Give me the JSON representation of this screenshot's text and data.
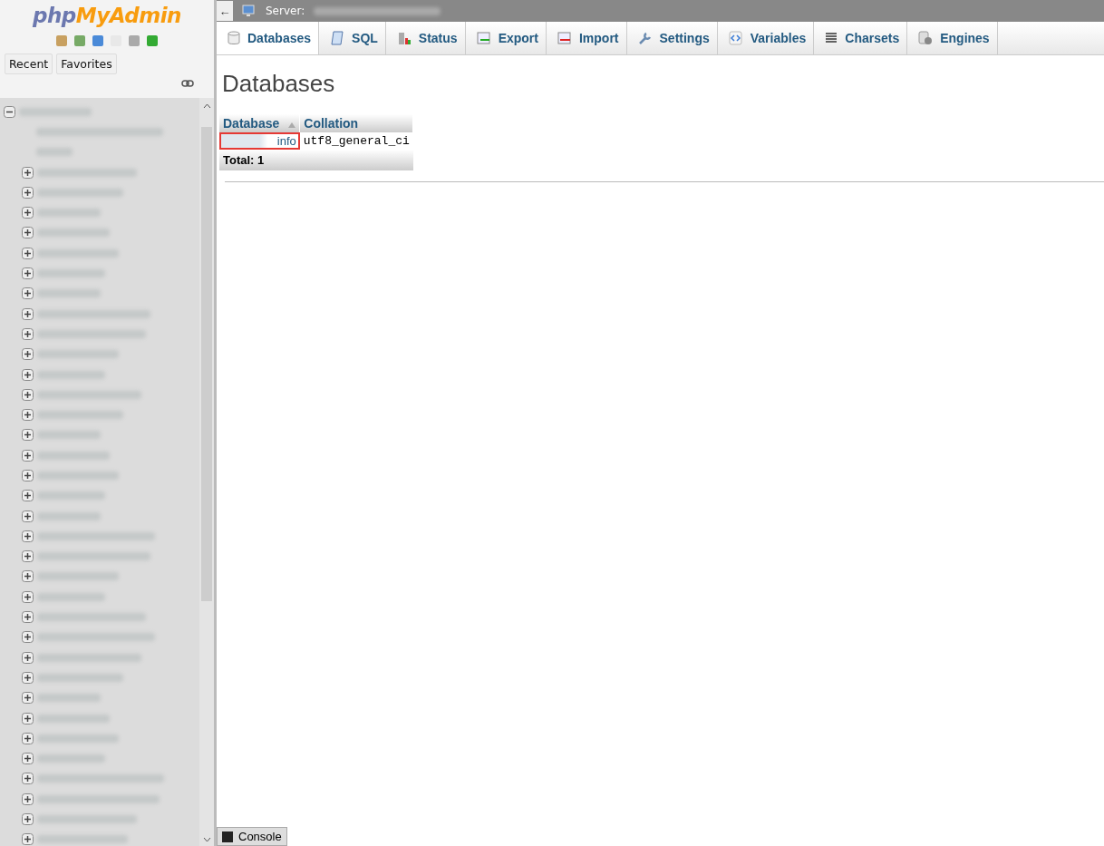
{
  "logo": {
    "part1": "php",
    "part2": "MyAdmin"
  },
  "nav_buttons": [
    "Recent",
    "Favorites"
  ],
  "tree": {
    "expanded": true,
    "items": [
      {
        "expanded": false
      },
      {
        "expanded": false
      },
      {
        "expanded": false
      },
      {
        "expanded": false
      },
      {
        "expanded": false
      },
      {
        "expanded": false
      },
      {
        "expanded": false
      },
      {
        "expanded": false
      },
      {
        "expanded": false
      },
      {
        "expanded": false
      },
      {
        "expanded": false
      },
      {
        "expanded": false
      },
      {
        "expanded": false
      },
      {
        "expanded": false
      },
      {
        "expanded": false
      },
      {
        "expanded": false
      },
      {
        "expanded": false
      },
      {
        "expanded": false
      },
      {
        "expanded": false
      },
      {
        "expanded": false
      },
      {
        "expanded": false
      },
      {
        "expanded": false
      },
      {
        "expanded": false
      },
      {
        "expanded": false
      },
      {
        "expanded": false
      },
      {
        "expanded": false
      },
      {
        "expanded": false
      },
      {
        "expanded": false
      },
      {
        "expanded": false
      },
      {
        "expanded": false
      },
      {
        "expanded": false
      },
      {
        "expanded": false
      },
      {
        "expanded": false
      },
      {
        "expanded": false
      }
    ]
  },
  "breadcrumb": {
    "back": "←",
    "label": "Server:"
  },
  "tabs": [
    {
      "label": "Databases",
      "selected": true
    },
    {
      "label": "SQL",
      "selected": false
    },
    {
      "label": "Status",
      "selected": false
    },
    {
      "label": "Export",
      "selected": false
    },
    {
      "label": "Import",
      "selected": false
    },
    {
      "label": "Settings",
      "selected": false
    },
    {
      "label": "Variables",
      "selected": false
    },
    {
      "label": "Charsets",
      "selected": false
    },
    {
      "label": "Engines",
      "selected": false
    }
  ],
  "heading": "Databases",
  "table": {
    "columns": [
      {
        "label": "Database",
        "sorted": true
      },
      {
        "label": "Collation",
        "sorted": false
      }
    ],
    "rows": [
      {
        "database": "info",
        "collation": "utf8_general_ci",
        "highlighted": true
      }
    ],
    "total": "Total: 1"
  },
  "console": "Console"
}
